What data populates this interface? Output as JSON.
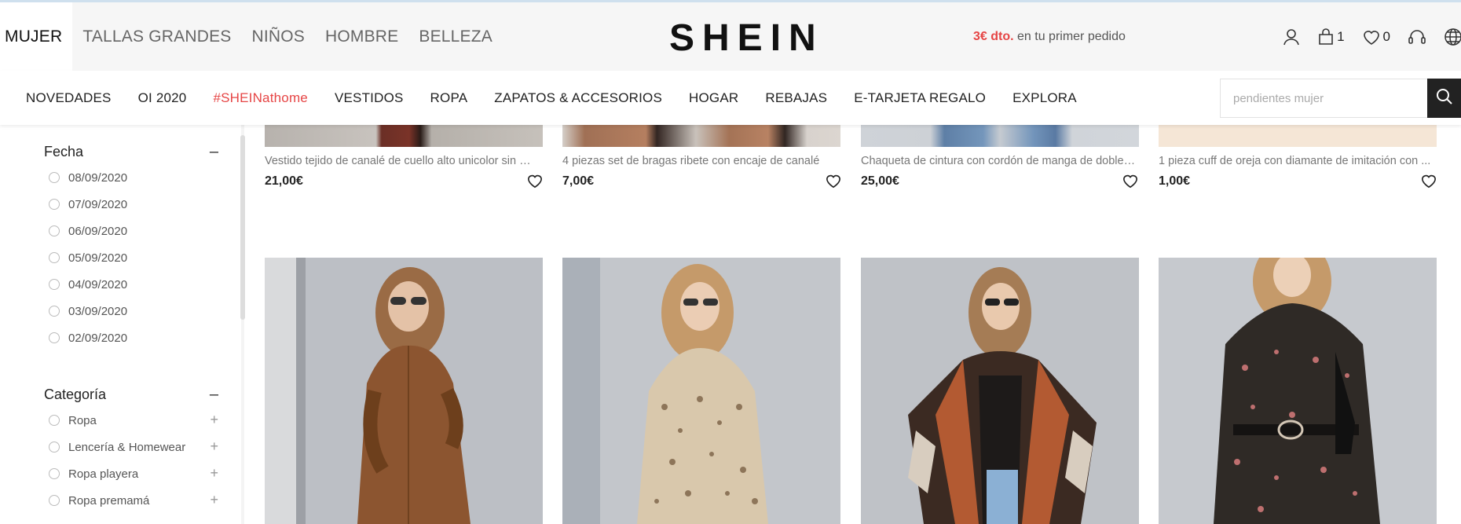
{
  "header": {
    "category_tabs": [
      "MUJER",
      "TALLAS GRANDES",
      "NIÑOS",
      "HOMBRE",
      "BELLEZA"
    ],
    "logo": "SHEIN",
    "promo_highlight": "3€ dto.",
    "promo_text": "en tu primer pedido",
    "cart_count": "1",
    "wishlist_count": "0"
  },
  "nav": {
    "items": [
      "NOVEDADES",
      "OI 2020",
      "#SHEINathome",
      "VESTIDOS",
      "ROPA",
      "ZAPATOS & ACCESORIOS",
      "HOGAR",
      "REBAJAS",
      "E-TARJETA REGALO",
      "EXPLORA"
    ],
    "search_placeholder": "pendientes mujer"
  },
  "sidebar": {
    "date_filter": {
      "title": "Fecha",
      "options": [
        "08/09/2020",
        "07/09/2020",
        "06/09/2020",
        "05/09/2020",
        "04/09/2020",
        "03/09/2020",
        "02/09/2020"
      ]
    },
    "category_filter": {
      "title": "Categoría",
      "options": [
        "Ropa",
        "Lencería & Homewear",
        "Ropa playera",
        "Ropa premamá"
      ]
    }
  },
  "products_row1": [
    {
      "title": "Vestido tejido de canalé de cuello alto unicolor sin mangas",
      "price": "21,00€"
    },
    {
      "title": "4 piezas set de bragas ribete con encaje de canalé",
      "price": "7,00€"
    },
    {
      "title": "Chaqueta de cintura con cordón de manga de doble capa",
      "price": "25,00€"
    },
    {
      "title": "1 pieza cuff de oreja con diamante de imitación con ...",
      "price": "1,00€"
    }
  ],
  "colors": {
    "accent_red": "#e64545",
    "topbar_bg": "#f6f6f6",
    "search_button": "#222222"
  }
}
